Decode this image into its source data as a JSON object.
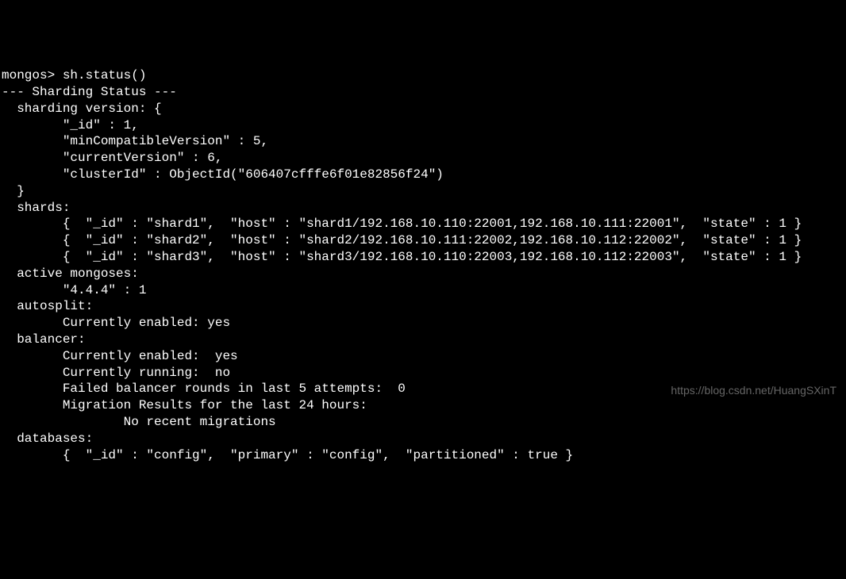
{
  "prompt": "mongos> ",
  "command": "sh.status()",
  "header": "--- Sharding Status ---",
  "sharding_version_label": "  sharding version: {",
  "sv_id": "        \"_id\" : 1,",
  "sv_mincompat": "        \"minCompatibleVersion\" : 5,",
  "sv_current": "        \"currentVersion\" : 6,",
  "sv_cluster": "        \"clusterId\" : ObjectId(\"606407cfffe6f01e82856f24\")",
  "sv_close": "  }",
  "shards_label": "  shards:",
  "shard1": "        {  \"_id\" : \"shard1\",  \"host\" : \"shard1/192.168.10.110:22001,192.168.10.111:22001\",  \"state\" : 1 }",
  "shard2": "        {  \"_id\" : \"shard2\",  \"host\" : \"shard2/192.168.10.111:22002,192.168.10.112:22002\",  \"state\" : 1 }",
  "shard3": "        {  \"_id\" : \"shard3\",  \"host\" : \"shard3/192.168.10.110:22003,192.168.10.112:22003\",  \"state\" : 1 }",
  "active_mongoses_label": "  active mongoses:",
  "active_mongoses_val": "        \"4.4.4\" : 1",
  "autosplit_label": "  autosplit:",
  "autosplit_val": "        Currently enabled: yes",
  "balancer_label": "  balancer:",
  "balancer_enabled": "        Currently enabled:  yes",
  "balancer_running": "        Currently running:  no",
  "balancer_failed": "        Failed balancer rounds in last 5 attempts:  0",
  "balancer_migration_label": "        Migration Results for the last 24 hours:",
  "balancer_migration_val": "                No recent migrations",
  "databases_label": "  databases:",
  "database1": "        {  \"_id\" : \"config\",  \"primary\" : \"config\",  \"partitioned\" : true }",
  "watermark": "https://blog.csdn.net/HuangSXinT"
}
